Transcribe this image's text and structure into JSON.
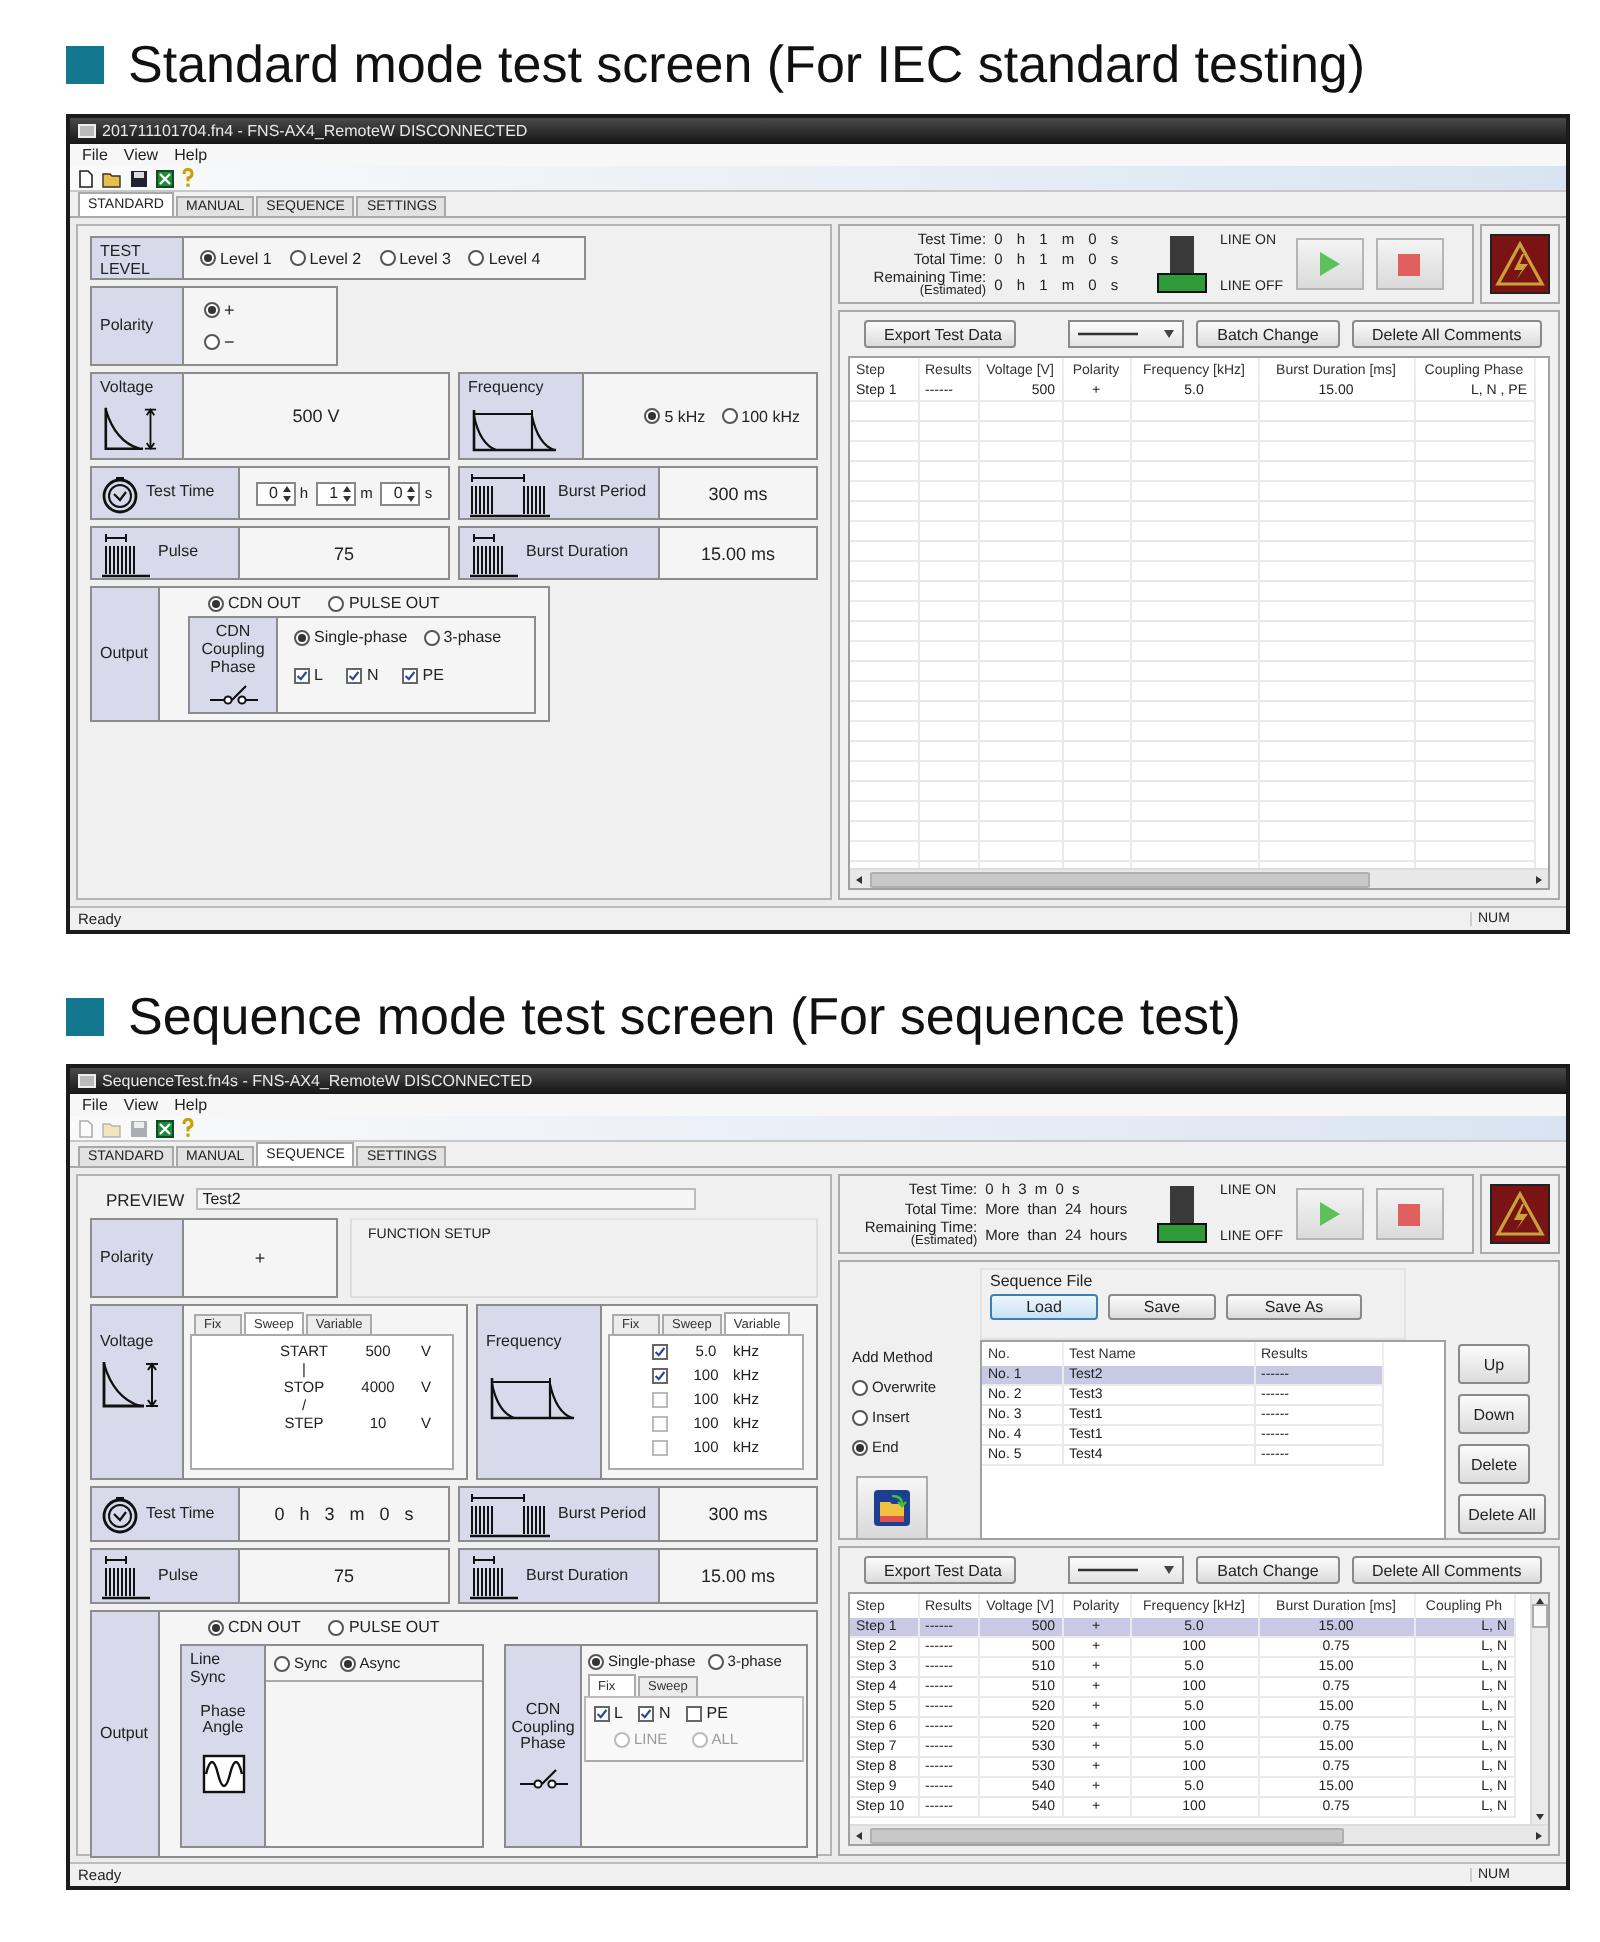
{
  "sections": [
    {
      "heading": "Standard mode test screen (For IEC standard testing)",
      "window": {
        "kind": "standard",
        "title": "201711101704.fn4 - FNS-AX4_RemoteW DISCONNECTED",
        "menu": [
          "File",
          "View",
          "Help"
        ],
        "toolbar": [
          {
            "kind": "new",
            "disabled": false
          },
          {
            "kind": "open",
            "disabled": false
          },
          {
            "kind": "save",
            "disabled": false
          },
          {
            "kind": "spreadsheet",
            "disabled": false
          },
          {
            "kind": "help",
            "disabled": false
          }
        ],
        "tabs": [
          {
            "label": "STANDARD",
            "selected": true
          },
          {
            "label": "MANUAL",
            "selected": false
          },
          {
            "label": "SEQUENCE",
            "selected": false
          },
          {
            "label": "SETTINGS",
            "selected": false
          }
        ],
        "settings": {
          "test_level": {
            "label": "TEST LEVEL",
            "options": [
              {
                "label": "Level 1",
                "selected": true
              },
              {
                "label": "Level 2",
                "selected": false
              },
              {
                "label": "Level 3",
                "selected": false
              },
              {
                "label": "Level 4",
                "selected": false
              }
            ]
          },
          "polarity": {
            "label": "Polarity",
            "options": [
              {
                "label": "+",
                "selected": true
              },
              {
                "label": "−",
                "selected": false
              }
            ]
          },
          "voltage": {
            "label": "Voltage",
            "value": "500 V"
          },
          "frequency": {
            "label": "Frequency",
            "options": [
              {
                "label": "5 kHz",
                "selected": true
              },
              {
                "label": "100 kHz",
                "selected": false
              }
            ]
          },
          "test_time": {
            "label": "Test Time",
            "fields": [
              {
                "value": "0",
                "unit": "h"
              },
              {
                "value": "1",
                "unit": "m"
              },
              {
                "value": "0",
                "unit": "s"
              }
            ]
          },
          "burst_period": {
            "label": "Burst Period",
            "value": "300 ms"
          },
          "pulse": {
            "label": "Pulse",
            "value": "75"
          },
          "burst_duration": {
            "label": "Burst Duration",
            "value": "15.00 ms"
          },
          "output": {
            "label": "Output",
            "modes": [
              {
                "label": "CDN OUT",
                "selected": true
              },
              {
                "label": "PULSE OUT",
                "selected": false
              }
            ],
            "coupling": {
              "label": "CDN Coupling Phase",
              "phases": [
                {
                  "label": "Single-phase",
                  "selected": true
                },
                {
                  "label": "3-phase",
                  "selected": false
                }
              ],
              "lines": [
                {
                  "label": "L",
                  "checked": true
                },
                {
                  "label": "N",
                  "checked": true
                },
                {
                  "label": "PE",
                  "checked": true
                }
              ]
            }
          }
        },
        "status_panel": {
          "times": [
            {
              "label": "Test Time:",
              "value": "0 h 1 m 0 s"
            },
            {
              "label": "Total Time:",
              "value": "0 h 1 m 0 s"
            },
            {
              "label": "Remaining Time:",
              "note": "(Estimated)",
              "value": "0 h 1 m 0 s"
            }
          ],
          "line_on_label": "LINE ON",
          "line_off_label": "LINE OFF",
          "line_on": false
        },
        "results": {
          "export": "Export Test Data",
          "batch": "Batch Change",
          "delete_comments": "Delete All Comments",
          "columns": [
            "Step",
            "Results",
            "Voltage [V]",
            "Polarity",
            "Frequency [kHz]",
            "Burst Duration [ms]",
            "Coupling Phase"
          ],
          "rows": [
            {
              "selected": false,
              "cells": [
                "Step 1",
                "------",
                "500",
                "+",
                "5.0",
                "15.00",
                "L, N , PE"
              ]
            }
          ]
        },
        "status": "Ready",
        "indicator": "NUM"
      }
    },
    {
      "heading": "Sequence mode test screen (For sequence test)",
      "window": {
        "kind": "sequence",
        "title": "SequenceTest.fn4s - FNS-AX4_RemoteW DISCONNECTED",
        "menu": [
          "File",
          "View",
          "Help"
        ],
        "toolbar": [
          {
            "kind": "new",
            "disabled": true
          },
          {
            "kind": "open",
            "disabled": true
          },
          {
            "kind": "save",
            "disabled": true
          },
          {
            "kind": "spreadsheet",
            "disabled": false
          },
          {
            "kind": "help",
            "disabled": false
          }
        ],
        "tabs": [
          {
            "label": "STANDARD",
            "selected": false
          },
          {
            "label": "MANUAL",
            "selected": false
          },
          {
            "label": "SEQUENCE",
            "selected": true
          },
          {
            "label": "SETTINGS",
            "selected": false
          }
        ],
        "settings": {
          "preview": {
            "label": "PREVIEW",
            "value": "Test2"
          },
          "function_setup": "FUNCTION SETUP",
          "polarity": {
            "label": "Polarity",
            "value": "+"
          },
          "voltage": {
            "label": "Voltage",
            "tabs": [
              {
                "label": "Fix",
                "selected": false
              },
              {
                "label": "Sweep",
                "selected": true
              },
              {
                "label": "Variable",
                "selected": false
              }
            ],
            "sweep": [
              {
                "kind": "value",
                "label": "START",
                "value": "500",
                "unit": "V"
              },
              {
                "kind": "separator",
                "text": "|"
              },
              {
                "kind": "value",
                "label": "STOP",
                "value": "4000",
                "unit": "V"
              },
              {
                "kind": "separator",
                "text": "/"
              },
              {
                "kind": "value",
                "label": "STEP",
                "value": "10",
                "unit": "V"
              }
            ]
          },
          "frequency": {
            "label": "Frequency",
            "tabs": [
              {
                "label": "Fix",
                "selected": false
              },
              {
                "label": "Sweep",
                "selected": false
              },
              {
                "label": "Variable",
                "selected": true
              }
            ],
            "variable": [
              {
                "checked": true,
                "value": "5.0",
                "unit": "kHz"
              },
              {
                "checked": true,
                "value": "100",
                "unit": "kHz"
              },
              {
                "checked": false,
                "value": "100",
                "unit": "kHz"
              },
              {
                "checked": false,
                "value": "100",
                "unit": "kHz"
              },
              {
                "checked": false,
                "value": "100",
                "unit": "kHz"
              }
            ]
          },
          "test_time": {
            "label": "Test Time",
            "value": "0 h 3 m 0 s"
          },
          "burst_period": {
            "label": "Burst Period",
            "value": "300 ms"
          },
          "pulse": {
            "label": "Pulse",
            "value": "75"
          },
          "burst_duration": {
            "label": "Burst Duration",
            "value": "15.00 ms"
          },
          "output": {
            "label": "Output",
            "modes": [
              {
                "label": "CDN OUT",
                "selected": true
              },
              {
                "label": "PULSE OUT",
                "selected": false
              }
            ],
            "line_sync": {
              "label": "Line Sync",
              "options": [
                {
                  "label": "Sync",
                  "selected": false
                },
                {
                  "label": "Async",
                  "selected": true
                }
              ]
            },
            "phase_angle": "Phase Angle",
            "coupling": {
              "label": "CDN Coupling Phase",
              "phases": [
                {
                  "label": "Single-phase",
                  "selected": true
                },
                {
                  "label": "3-phase",
                  "selected": false
                }
              ],
              "tabs": [
                {
                  "label": "Fix",
                  "selected": true
                },
                {
                  "label": "Sweep",
                  "selected": false
                }
              ],
              "lines": [
                {
                  "label": "L",
                  "checked": true
                },
                {
                  "label": "N",
                  "checked": true
                },
                {
                  "label": "PE",
                  "checked": false
                }
              ],
              "targets": [
                {
                  "label": "LINE",
                  "selected": false,
                  "disabled": true
                },
                {
                  "label": "ALL",
                  "selected": false,
                  "disabled": true
                }
              ]
            }
          }
        },
        "status_panel": {
          "times": [
            {
              "label": "Test Time:",
              "value": "0 h 3 m 0 s"
            },
            {
              "label": "Total Time:",
              "value": "More than 24 hours"
            },
            {
              "label": "Remaining Time:",
              "note": "(Estimated)",
              "value": "More than 24 hours"
            }
          ],
          "line_on_label": "LINE ON",
          "line_off_label": "LINE OFF",
          "line_on": false
        },
        "sequence": {
          "file_label": "Sequence File",
          "file_buttons": [
            {
              "label": "Load",
              "focused": true
            },
            {
              "label": "Save",
              "focused": false
            },
            {
              "label": "Save As",
              "focused": false
            }
          ],
          "add_method": {
            "label": "Add Method",
            "options": [
              {
                "label": "Overwrite",
                "selected": false
              },
              {
                "label": "Insert",
                "selected": false
              },
              {
                "label": "End",
                "selected": true
              }
            ]
          },
          "columns": [
            "No.",
            "Test Name",
            "Results"
          ],
          "rows": [
            {
              "selected": true,
              "cells": [
                "No. 1",
                "Test2",
                "------"
              ]
            },
            {
              "selected": false,
              "cells": [
                "No. 2",
                "Test3",
                "------"
              ]
            },
            {
              "selected": false,
              "cells": [
                "No. 3",
                "Test1",
                "------"
              ]
            },
            {
              "selected": false,
              "cells": [
                "No. 4",
                "Test1",
                "------"
              ]
            },
            {
              "selected": false,
              "cells": [
                "No. 5",
                "Test4",
                "------"
              ]
            }
          ],
          "buttons": [
            "Up",
            "Down",
            "Delete",
            "Delete All"
          ]
        },
        "results": {
          "export": "Export Test Data",
          "batch": "Batch Change",
          "delete_comments": "Delete All Comments",
          "columns": [
            "Step",
            "Results",
            "Voltage [V]",
            "Polarity",
            "Frequency [kHz]",
            "Burst Duration [ms]",
            "Coupling Ph"
          ],
          "rows": [
            {
              "selected": true,
              "cells": [
                "Step 1",
                "------",
                "500",
                "+",
                "5.0",
                "15.00",
                "L, N"
              ]
            },
            {
              "selected": false,
              "cells": [
                "Step 2",
                "------",
                "500",
                "+",
                "100",
                "0.75",
                "L, N"
              ]
            },
            {
              "selected": false,
              "cells": [
                "Step 3",
                "------",
                "510",
                "+",
                "5.0",
                "15.00",
                "L, N"
              ]
            },
            {
              "selected": false,
              "cells": [
                "Step 4",
                "------",
                "510",
                "+",
                "100",
                "0.75",
                "L, N"
              ]
            },
            {
              "selected": false,
              "cells": [
                "Step 5",
                "------",
                "520",
                "+",
                "5.0",
                "15.00",
                "L, N"
              ]
            },
            {
              "selected": false,
              "cells": [
                "Step 6",
                "------",
                "520",
                "+",
                "100",
                "0.75",
                "L, N"
              ]
            },
            {
              "selected": false,
              "cells": [
                "Step 7",
                "------",
                "530",
                "+",
                "5.0",
                "15.00",
                "L, N"
              ]
            },
            {
              "selected": false,
              "cells": [
                "Step 8",
                "------",
                "530",
                "+",
                "100",
                "0.75",
                "L, N"
              ]
            },
            {
              "selected": false,
              "cells": [
                "Step 9",
                "------",
                "540",
                "+",
                "5.0",
                "15.00",
                "L, N"
              ]
            },
            {
              "selected": false,
              "cells": [
                "Step 10",
                "------",
                "540",
                "+",
                "100",
                "0.75",
                "L, N"
              ]
            }
          ]
        },
        "status": "Ready",
        "indicator": "NUM"
      }
    }
  ]
}
